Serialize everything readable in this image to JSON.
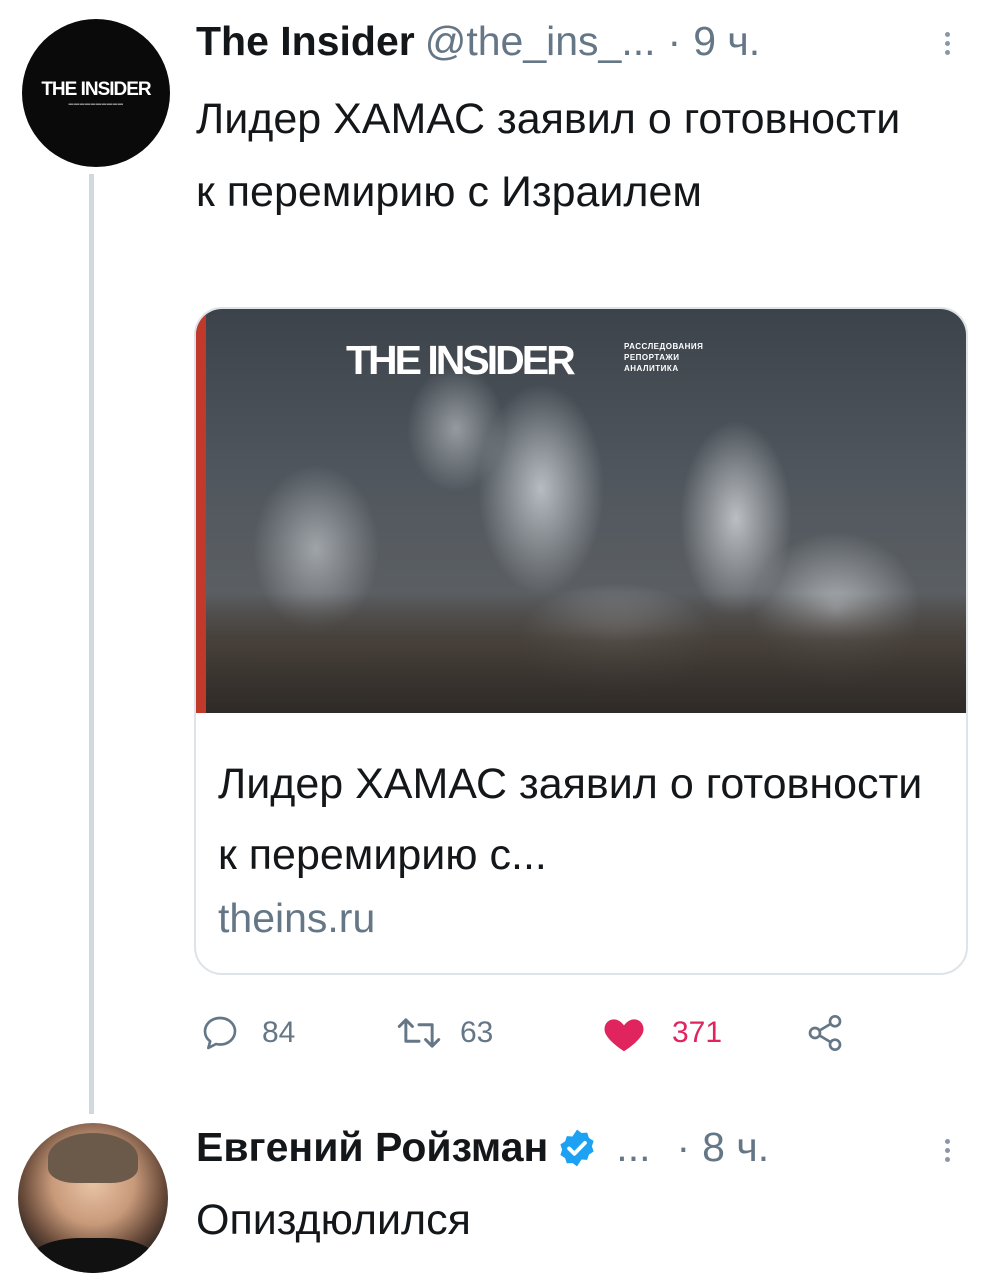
{
  "tweet1": {
    "avatar_logo": "THE INSIDER",
    "author_name": "The Insider",
    "handle": "@the_ins_...",
    "separator": "·",
    "time": "9 ч.",
    "text": "Лидер ХАМАС заявил о готовности к перемирию с Израилем",
    "card": {
      "image_logo": "THE INSIDER",
      "image_tagline": [
        "РАССЛЕДОВАНИЯ",
        "РЕПОРТАЖИ",
        "АНАЛИТИКА"
      ],
      "title": "Лидер ХАМАС заявил о готовности к перемирию с...",
      "domain": "theins.ru"
    },
    "actions": {
      "replies": "84",
      "retweets": "63",
      "likes": "371"
    }
  },
  "tweet2": {
    "author_name": "Евгений Ройзман",
    "handle": "...",
    "separator": "·",
    "time": "8 ч.",
    "text": "Опиздюлился"
  },
  "colors": {
    "text": "#14171a",
    "secondary": "#657786",
    "like": "#e0245e",
    "verified": "#1da1f2",
    "border": "#dde3e8",
    "thread_line": "#cfd9de"
  },
  "icons": [
    "reply-icon",
    "retweet-icon",
    "like-heart-icon",
    "share-icon",
    "more-icon",
    "verified-badge-icon"
  ]
}
